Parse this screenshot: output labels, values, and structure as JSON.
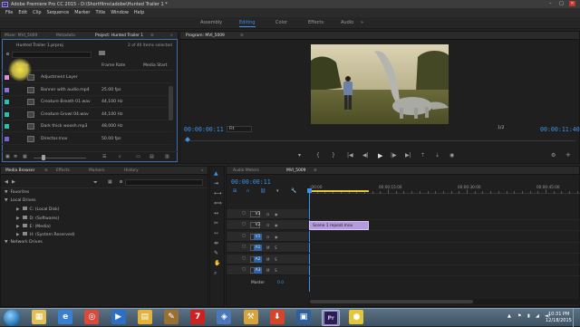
{
  "window": {
    "title": "Adobe Premiere Pro CC 2015 - D:\\Shortfilms\\adobe\\Hunted Trailer 1 *",
    "app_badge": "Pr",
    "minimize": "–",
    "maximize": "□",
    "close": "✕"
  },
  "menu": [
    "File",
    "Edit",
    "Clip",
    "Sequence",
    "Marker",
    "Title",
    "Window",
    "Help"
  ],
  "workspaces": {
    "items": [
      "Assembly",
      "Editing",
      "Color",
      "Effects",
      "Audio"
    ],
    "active": "Editing",
    "overflow": "»"
  },
  "project_panel": {
    "tabs": [
      "Mixer: MVI_5009",
      "Metadata",
      "Project: Hunted Trailer 1",
      "≡",
      "»"
    ],
    "project_file": "Hunted Trailer 1.prproj",
    "item_count": "2 of 40 items selected",
    "search_icon": "search-icon",
    "columns": {
      "name": "Name",
      "frame_rate": "Frame Rate",
      "media_start": "Media Start"
    },
    "items": [
      {
        "name": "Adjustment Layer",
        "frame_rate": "",
        "color": "#e08fd8"
      },
      {
        "name": "Banner with audio.mp4",
        "frame_rate": "25.00 fps",
        "color": "#8e6fdb"
      },
      {
        "name": "Creature Breath 01.wav",
        "frame_rate": "44,100 Hz",
        "color": "#2fbfa6"
      },
      {
        "name": "Creature Growl 04.wav",
        "frame_rate": "44,100 Hz",
        "color": "#2fbfa6"
      },
      {
        "name": "Dark thick woosh.mp3",
        "frame_rate": "48,000 Hz",
        "color": "#2fbfa6"
      },
      {
        "name": "Director.mov",
        "frame_rate": "50.00 fps",
        "color": "#7c5fd0"
      }
    ],
    "bottom_icons": [
      "lock-icon",
      "list-view-icon",
      "icon-view-icon",
      "zoom-slider-icon",
      "sort-icon",
      "search-icon",
      "new-bin-icon",
      "new-item-icon",
      "delete-icon"
    ]
  },
  "program_monitor": {
    "tab": "Program: MVI_5009",
    "menu": "≡",
    "timecode_current": "00:00:00:11",
    "fit": "Fit",
    "resolution": "1/2",
    "timecode_duration": "00:00:11:40",
    "transport": [
      "marker-icon",
      "in-point-icon",
      "out-point-icon",
      "go-to-in-icon",
      "step-back-icon",
      "play-icon",
      "step-forward-icon",
      "go-to-out-icon",
      "lift-icon",
      "extract-icon",
      "export-frame-icon"
    ],
    "transport_glyphs": [
      "▾",
      "{",
      "}",
      "|◀",
      "◀|",
      "▶",
      "|▶",
      "▶|",
      "⇡",
      "⇣",
      "◉"
    ],
    "settings": "⚙",
    "add": "+"
  },
  "media_browser": {
    "tabs": [
      "Media Browser",
      "≡",
      "Effects",
      "Markers",
      "History",
      "»"
    ],
    "tree": [
      {
        "label": "Favorites",
        "level": 0
      },
      {
        "label": "Local Drives",
        "level": 0
      },
      {
        "label": "C: (Local Disk)",
        "level": 1
      },
      {
        "label": "D: (Softwares)",
        "level": 1
      },
      {
        "label": "E: (Media)",
        "level": 1
      },
      {
        "label": "H: (System Reserved)",
        "level": 1
      },
      {
        "label": "Network Drives",
        "level": 0
      }
    ]
  },
  "timeline": {
    "tabs": [
      "Audio Meters",
      "MVI_5009",
      "≡"
    ],
    "timecode": "00:00:00:11",
    "ruler_labels": [
      ":00:00",
      "00:00:15:00",
      "00:00:30:00",
      "00:00:45:00"
    ],
    "video_tracks": [
      "V3",
      "V2",
      "V1"
    ],
    "audio_tracks": [
      "A1",
      "A2",
      "A3"
    ],
    "master": {
      "label": "Master",
      "value": "0.0"
    },
    "clip": {
      "label": "Scene 1 repeat.mov",
      "color": "#b59ae0"
    },
    "toggle_video": [
      "⊡",
      "◉"
    ],
    "toggle_audio": [
      "M",
      "S"
    ]
  },
  "tools": [
    "selection-tool-icon",
    "track-select-tool-icon",
    "ripple-edit-tool-icon",
    "rolling-edit-tool-icon",
    "rate-stretch-tool-icon",
    "razor-tool-icon",
    "slip-tool-icon",
    "slide-tool-icon",
    "pen-tool-icon",
    "hand-tool-icon",
    "zoom-tool-icon"
  ],
  "tool_glyphs": [
    "▲",
    "⇥",
    "⟷",
    "⟺",
    "↔",
    "✂",
    "⇿",
    "⇹",
    "✎",
    "✋",
    "⌕"
  ],
  "taskbar": {
    "start_icon": "start-orb-icon",
    "apps": [
      {
        "name": "explorer-icon",
        "glyph": "▦",
        "color": "#e0c055"
      },
      {
        "name": "ie-icon",
        "glyph": "e",
        "color": "#3a7fd0"
      },
      {
        "name": "chrome-icon",
        "glyph": "◎",
        "color": "#d94a3a"
      },
      {
        "name": "media-icon",
        "glyph": "▶",
        "color": "#2e6fc6"
      },
      {
        "name": "folder-icon",
        "glyph": "▤",
        "color": "#e2b23a"
      },
      {
        "name": "paint-icon",
        "glyph": "✎",
        "color": "#9a7030"
      },
      {
        "name": "seven-zip-icon",
        "glyph": "7",
        "color": "#cc2222"
      },
      {
        "name": "control-panel-icon",
        "glyph": "◈",
        "color": "#4a78b8"
      },
      {
        "name": "tools-icon",
        "glyph": "⚒",
        "color": "#d7a33a"
      },
      {
        "name": "download-icon",
        "glyph": "⬇",
        "color": "#d6452a"
      },
      {
        "name": "player-icon",
        "glyph": "▣",
        "color": "#2f5f9a"
      },
      {
        "name": "premiere-icon",
        "glyph": "Pr",
        "color": "#2a1f4a"
      },
      {
        "name": "bandicam-icon",
        "glyph": "●",
        "color": "#e4c638"
      }
    ],
    "tray": [
      "▲",
      "⚑",
      "▮",
      "◢",
      "◄)"
    ],
    "time": "10:31 PM",
    "date": "12/18/2015"
  }
}
